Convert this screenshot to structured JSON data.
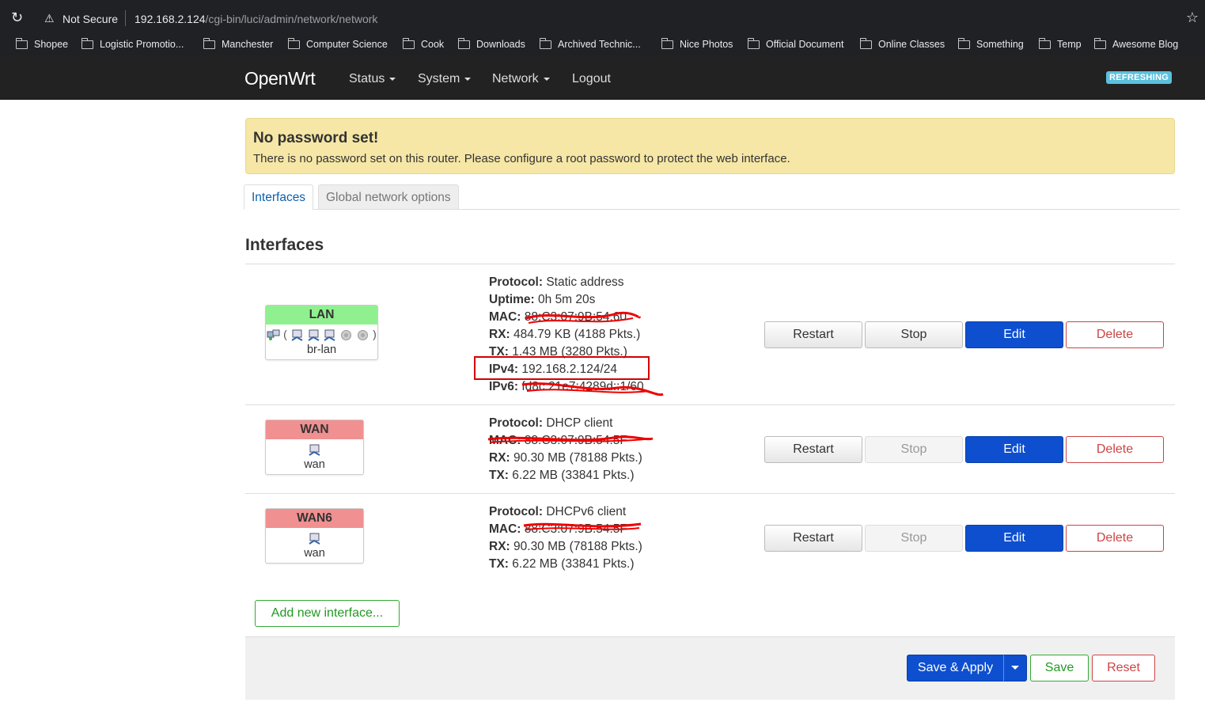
{
  "browser": {
    "security_label": "Not Secure",
    "url_host": "192.168.2.124",
    "url_path": "/cgi-bin/luci/admin/network/network",
    "bookmarks": [
      "Shopee",
      "Logistic Promotio...",
      "Manchester",
      "Computer Science",
      "Cook",
      "Downloads",
      "Archived Technic...",
      "Nice Photos",
      "Official Document",
      "Online Classes",
      "Something",
      "Temp",
      "Awesome Blog"
    ]
  },
  "nav": {
    "brand": "OpenWrt",
    "items": [
      "Status",
      "System",
      "Network",
      "Logout"
    ],
    "indicator": "REFRESHING"
  },
  "alert": {
    "title": "No password set!",
    "message": "There is no password set on this router. Please configure a root password to protect the web interface."
  },
  "tabs": [
    "Interfaces",
    "Global network options"
  ],
  "section_title": "Interfaces",
  "interfaces": [
    {
      "name": "LAN",
      "device": "br-lan",
      "protocol": "Static address",
      "uptime": "0h 5m 20s",
      "mac": "88:C3:07:9B:54:60",
      "rx": "484.79 KB (4188 Pkts.)",
      "tx": "1.43 MB (3280 Pkts.)",
      "ipv4": "192.168.2.124/24",
      "ipv6": "fd8c:21e7:4289d::1/60"
    },
    {
      "name": "WAN",
      "device": "wan",
      "protocol": "DHCP client",
      "mac": "88:C3:07:9B:54:5F",
      "rx": "90.30 MB (78188 Pkts.)",
      "tx": "6.22 MB (33841 Pkts.)"
    },
    {
      "name": "WAN6",
      "device": "wan",
      "protocol": "DHCPv6 client",
      "mac": "88:C3:07:9B:54:5F",
      "rx": "90.30 MB (78188 Pkts.)",
      "tx": "6.22 MB (33841 Pkts.)"
    }
  ],
  "labels": {
    "protocol": "Protocol:",
    "uptime": "Uptime:",
    "mac": "MAC:",
    "rx": "RX:",
    "tx": "TX:",
    "ipv4": "IPv4:",
    "ipv6": "IPv6:"
  },
  "buttons": {
    "restart": "Restart",
    "stop": "Stop",
    "edit": "Edit",
    "delete": "Delete",
    "add_interface": "Add new interface...",
    "save_apply": "Save & Apply",
    "save": "Save",
    "reset": "Reset"
  },
  "colors": {
    "primary": "#0d4fcf",
    "danger": "#cc4444",
    "alert_bg": "#f6e7a6",
    "lan_header": "#90f090",
    "wan_header": "#f09090",
    "indicator": "#5bc0de"
  }
}
